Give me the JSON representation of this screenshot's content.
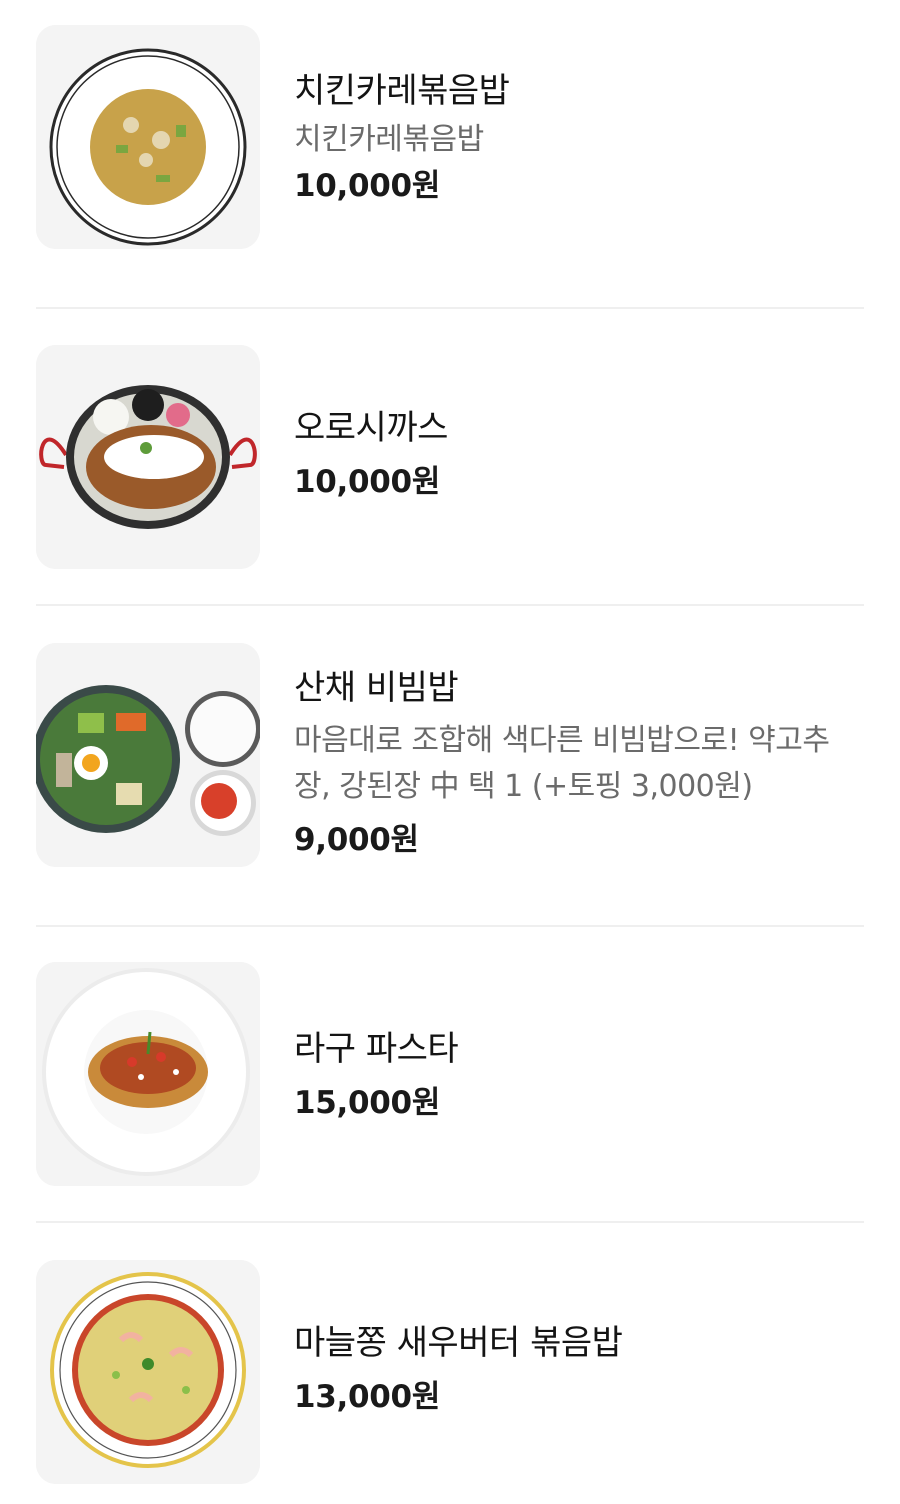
{
  "menu": {
    "items": [
      {
        "name": "치킨카레볶음밥",
        "description": "치킨카레볶음밥",
        "price": "10,000원"
      },
      {
        "name": "오로시까스",
        "price": "10,000원"
      },
      {
        "name": "산채 비빔밥",
        "description": "마음대로 조합해 색다른 비빔밥으로! 약고추장, 강된장 中 택 1 (+토핑 3,000원)",
        "price": "9,000원"
      },
      {
        "name": "라구 파스타",
        "price": "15,000원"
      },
      {
        "name": "마늘쫑 새우버터 볶음밥",
        "price": "13,000원"
      }
    ]
  }
}
